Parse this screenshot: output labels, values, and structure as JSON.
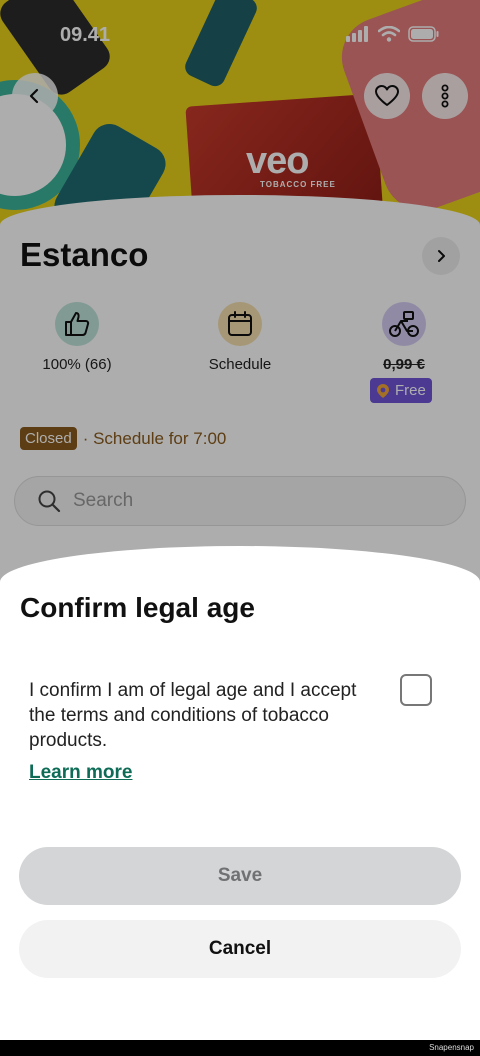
{
  "status_bar": {
    "time": "09.41"
  },
  "hero": {
    "brand": "veo",
    "brand_sub": "TOBACCO FREE"
  },
  "store": {
    "title": "Estanco",
    "rating": "100% (66)",
    "schedule_label": "Schedule",
    "delivery_fee": "0,99 €",
    "free_label": "Free",
    "closed_badge": "Closed",
    "schedule_text": "· Schedule for 7:00"
  },
  "search": {
    "placeholder": "Search"
  },
  "dialog": {
    "title": "Confirm legal age",
    "body": "I confirm I am of legal age and I accept the terms and conditions of tobacco products.",
    "link": "Learn more",
    "save_label": "Save",
    "cancel_label": "Cancel"
  },
  "watermark": "Snapensnap",
  "colors": {
    "accent_green": "#0d6b56",
    "badge_purple": "#6f55d8",
    "closed_brown": "#8a5b1c",
    "hero_yellow": "#e8d21a"
  }
}
